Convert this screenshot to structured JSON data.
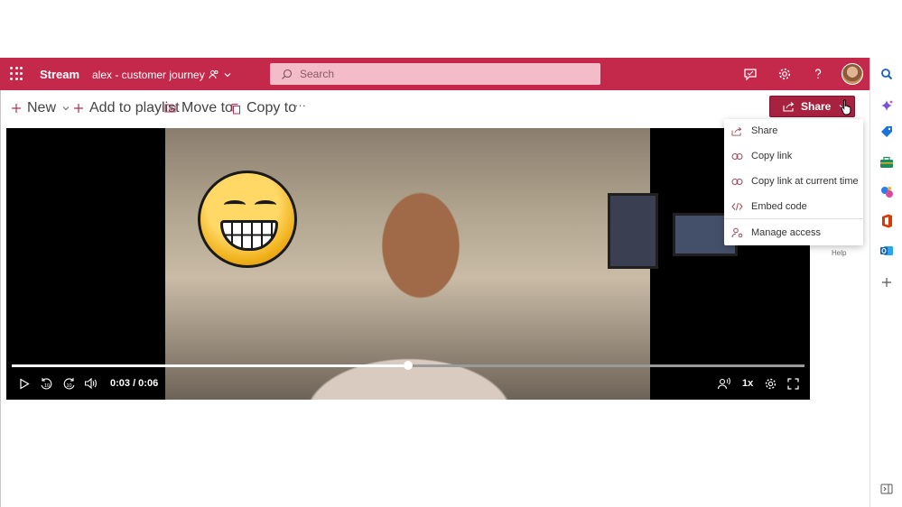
{
  "header": {
    "app_name": "Stream",
    "breadcrumb": "alex - customer journey",
    "search_placeholder": "Search"
  },
  "toolbar": {
    "new_label": "New",
    "add_to_playlist_label": "Add to playlist",
    "move_to_label": "Move to",
    "copy_to_label": "Copy to",
    "more_label": "···",
    "share_label": "Share"
  },
  "share_menu": {
    "items": [
      {
        "label": "Share",
        "icon": "share-icon"
      },
      {
        "label": "Copy link",
        "icon": "link-icon"
      },
      {
        "label": "Copy link at current time",
        "icon": "link-icon"
      },
      {
        "label": "Embed code",
        "icon": "code-icon"
      },
      {
        "label": "Manage access",
        "icon": "people-icon"
      }
    ]
  },
  "player": {
    "time": "0:03 / 0:06",
    "progress": 0.5,
    "speed": "1x"
  },
  "side_hint": "Help",
  "colors": {
    "brand": "#c4284a",
    "share_button": "#a8213f",
    "search_bg": "#f3bcc8"
  }
}
